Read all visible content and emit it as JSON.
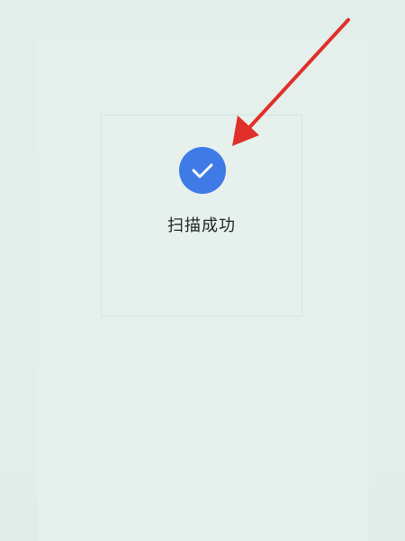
{
  "scan_result": {
    "status_text": "扫描成功",
    "icon": "check-icon",
    "badge_color": "#3f7ae6"
  },
  "annotation": {
    "arrow_color": "#e02f2a"
  }
}
